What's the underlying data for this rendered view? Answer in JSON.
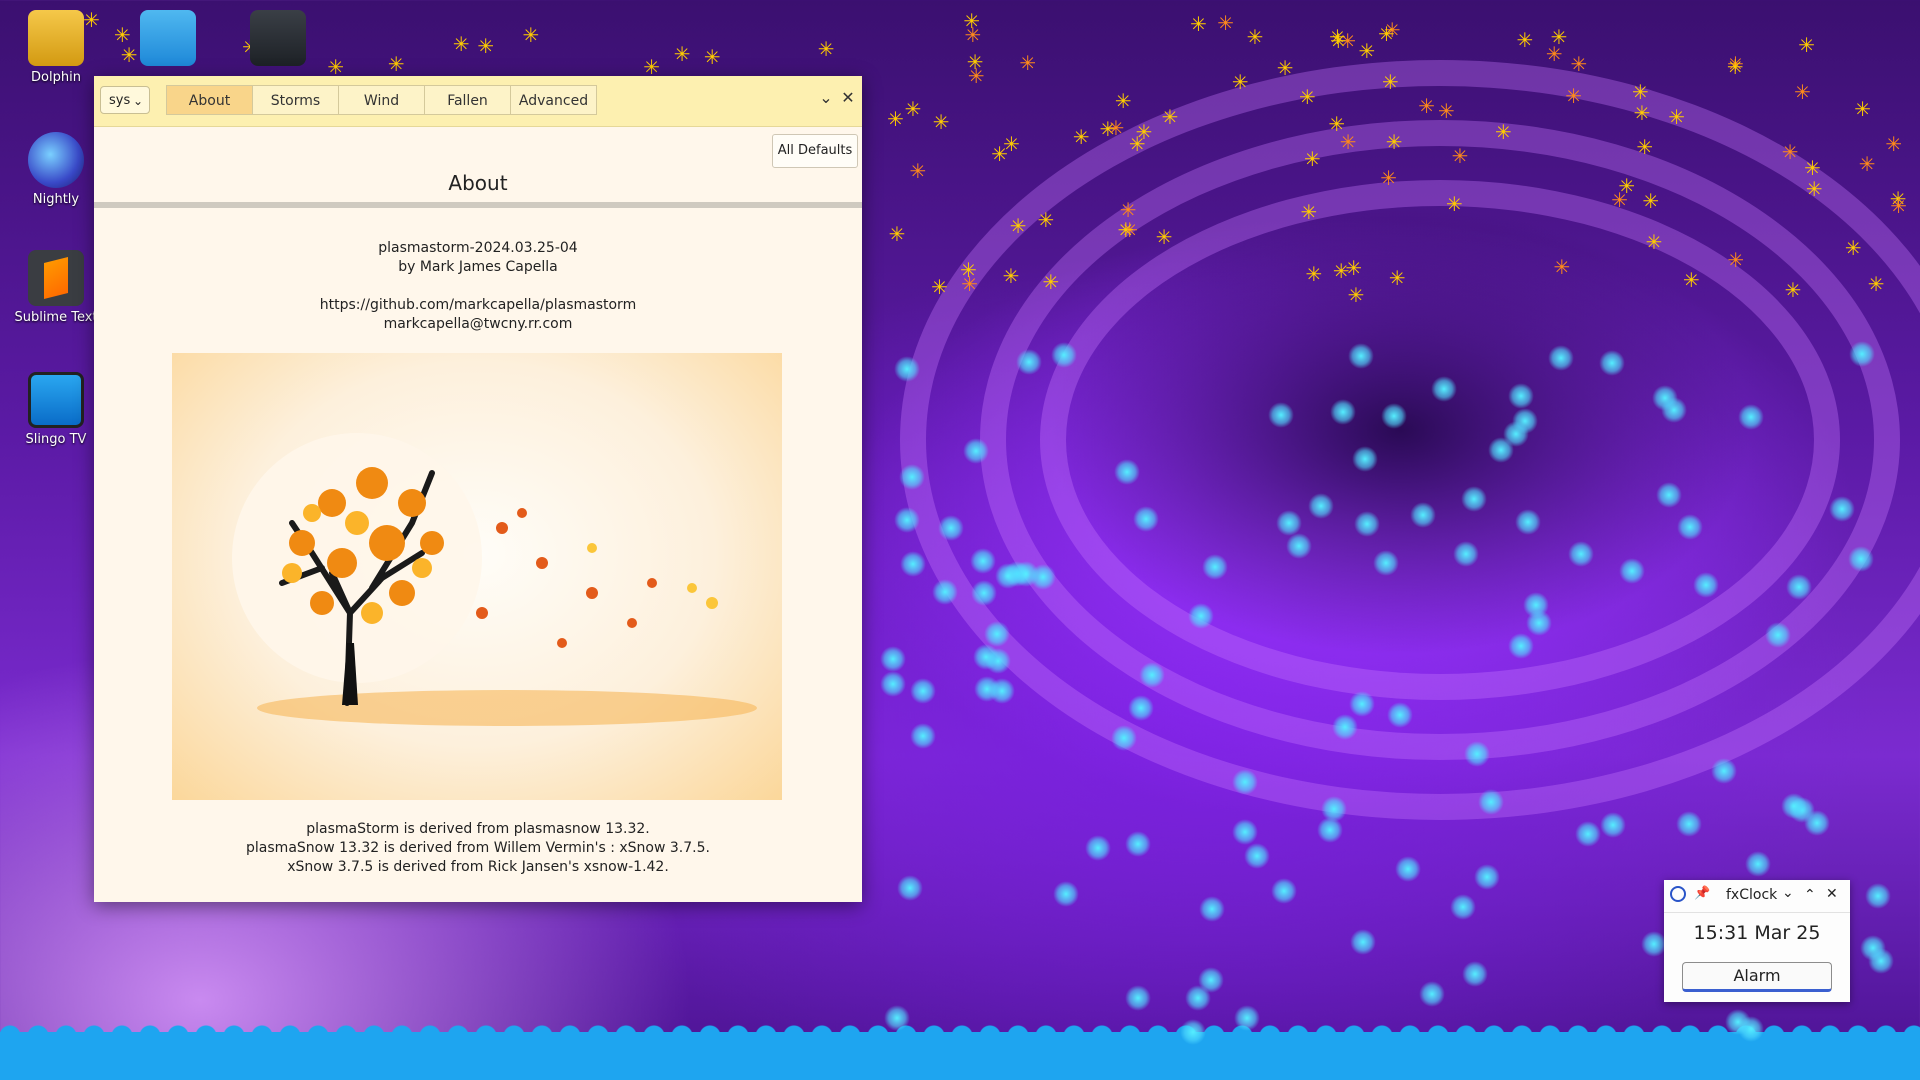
{
  "desktop": {
    "icons": [
      {
        "label": "Dolphin",
        "icon": "computer-icon"
      },
      {
        "label": "",
        "icon": "folder-icon"
      },
      {
        "label": "",
        "icon": "settings-panel-icon"
      },
      {
        "label": "Nightly",
        "icon": "firefox-nightly-icon"
      },
      {
        "label": "Sublime Text",
        "icon": "sublime-text-icon"
      },
      {
        "label": "Slingo TV",
        "icon": "tv-icon"
      }
    ]
  },
  "window": {
    "sys_label": "sys",
    "tabs": [
      "About",
      "Storms",
      "Wind",
      "Fallen",
      "Advanced"
    ],
    "active_tab": "About",
    "all_defaults_label": "All Defaults",
    "heading": "About",
    "version": "plasmastorm-2024.03.25-04",
    "author": "by Mark James Capella",
    "url": "https://github.com/markcapella/plasmastorm",
    "email": "markcapella@twcny.rr.com",
    "credits": [
      "plasmaStorm is derived from plasmasnow 13.32.",
      "plasmaSnow 13.32 is derived from Willem Vermin's : xSnow 3.7.5.",
      "xSnow 3.7.5 is derived from Rick Jansen's xsnow-1.42."
    ]
  },
  "clock": {
    "title": "fxClock",
    "time": "15:31",
    "date": "Mar 25",
    "alarm_label": "Alarm"
  },
  "colors": {
    "titlebar": "#fdf0b0",
    "active_tab": "#f9d58a",
    "window_bg": "#fff7eb",
    "snow_ground": "#1ea5f0"
  }
}
